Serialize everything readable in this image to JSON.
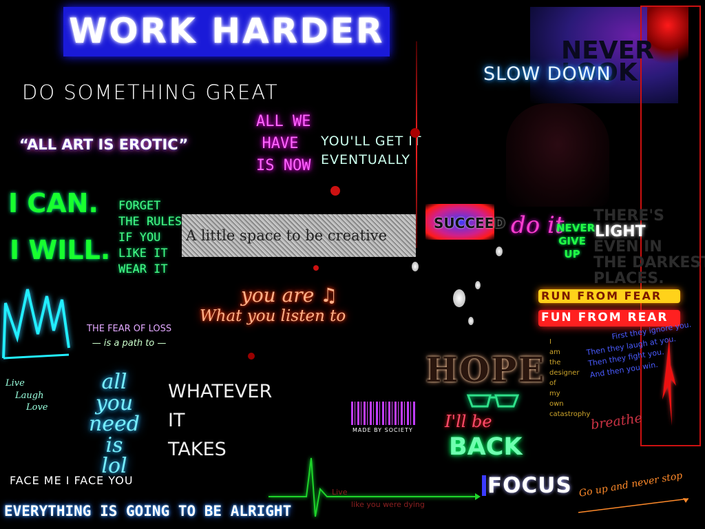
{
  "collage": {
    "work_harder": "WORK HARDER",
    "do_something": "DO SOMETHING GREAT",
    "all_art": "“ALL ART IS EROTIC”",
    "all_we_have": [
      "ALL WE",
      "HAVE",
      "IS NOW"
    ],
    "youll_get_it": [
      "YOU'LL GET IT",
      "EVENTUALLY"
    ],
    "slow_down": "SLOW DOWN",
    "never_look": [
      "NEVER",
      "LOOK"
    ],
    "i_can": "I CAN.",
    "i_will": "I WILL.",
    "forget_rules": [
      "FORGET",
      "THE RULES",
      "IF YOU",
      "LIKE IT",
      "WEAR IT"
    ],
    "little_space": "A little space to be creative",
    "succeed": "SUCCEED",
    "do_it": "do it",
    "never_give_up": [
      "NEVER",
      "GIVE",
      "UP"
    ],
    "light": "LIGHT",
    "theres_even": [
      "THERE'S",
      "EVEN IN",
      "THE DARKEST",
      "PLACES."
    ],
    "run_fear": "RUN FROM FEAR",
    "fun_rear": "FUN FROM REAR",
    "you_are": [
      "you are ♫",
      "What you listen to"
    ],
    "fear_loss": [
      "THE FEAR OF LOSS",
      "— is a path to —"
    ],
    "live_laugh_love": [
      "Live",
      "Laugh",
      "Love"
    ],
    "all_you_need": [
      "all",
      "you",
      "need",
      "is",
      "lol"
    ],
    "whatever": [
      "WHATEVER",
      "IT",
      "TAKES"
    ],
    "hope": "HOPE",
    "made_by": "MADE BY SOCIETY",
    "ill_be": "I'll be",
    "back": "BACK",
    "designer": [
      "I",
      "am",
      "the",
      "designer",
      "of",
      "my",
      "own",
      "catastrophy"
    ],
    "first_ignore": [
      "First they ignore you.",
      "Then they laugh at you.",
      "Then they fight you.",
      "And then you win."
    ],
    "breathe": "breathe",
    "face_me": "FACE ME I FACE YOU",
    "everything": "EVERYTHING IS GOING TO BE ALRIGHT",
    "live_dying": [
      "Live",
      "like you were dying"
    ],
    "focus": "FOCUS",
    "go_up": "Go up and never stop"
  },
  "colors": {
    "background": "#000000",
    "work_harder_bg": "#1a1ad8",
    "neon_green": "#18ff2f",
    "neon_red": "#ff2020",
    "neon_blue": "#3b3bff",
    "yellow": "#ffd21a"
  }
}
